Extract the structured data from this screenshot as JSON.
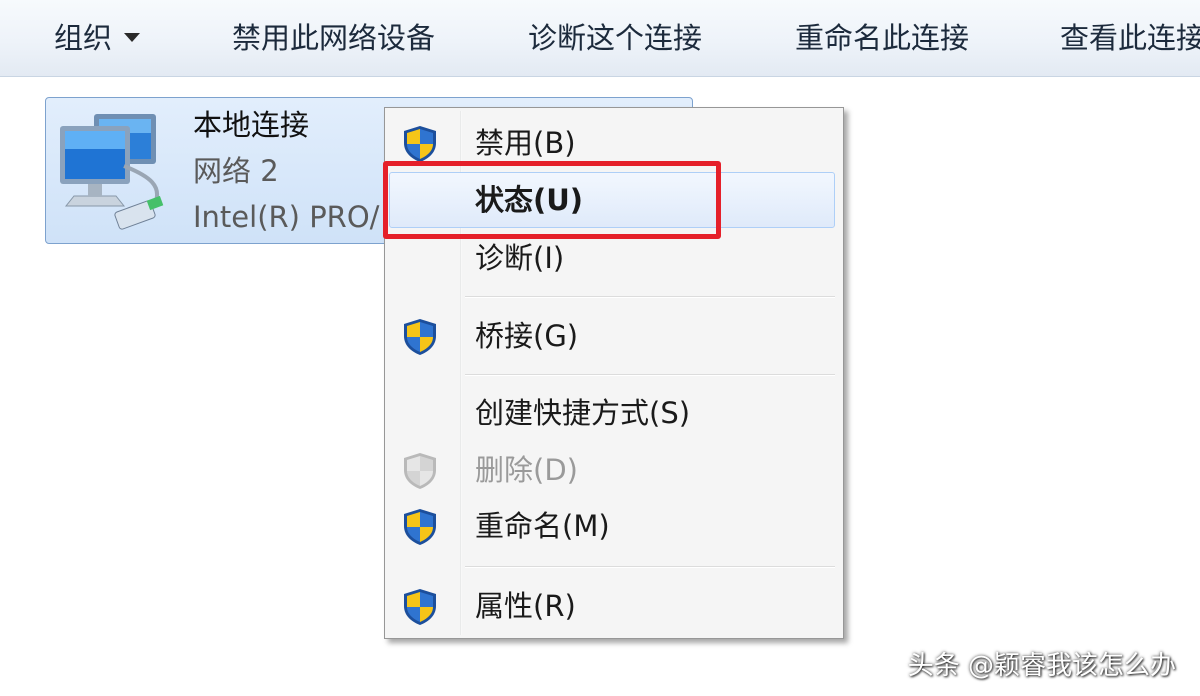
{
  "toolbar": {
    "organize_label": "组织",
    "disable_device_label": "禁用此网络设备",
    "diagnose_label": "诊断这个连接",
    "rename_label": "重命名此连接",
    "view_status_label": "查看此连接"
  },
  "connection": {
    "name": "本地连接",
    "network": "网络 2",
    "adapter": "Intel(R) PRO/"
  },
  "context_menu": {
    "items": [
      {
        "label": "禁用(B)",
        "icon": "uac-shield-icon"
      },
      {
        "label": "状态(U)",
        "icon": "none",
        "default": true,
        "highlighted": true
      },
      {
        "label": "诊断(I)",
        "icon": "none"
      },
      {
        "label": "桥接(G)",
        "icon": "uac-shield-icon"
      },
      {
        "label": "创建快捷方式(S)",
        "icon": "none"
      },
      {
        "label": "删除(D)",
        "icon": "uac-shield-icon",
        "disabled": true
      },
      {
        "label": "重命名(M)",
        "icon": "uac-shield-icon"
      },
      {
        "label": "属性(R)",
        "icon": "uac-shield-icon"
      }
    ]
  },
  "annotation": {
    "highlight_color": "#e5202a",
    "highlighted_item": "状态(U)"
  },
  "watermark": "头条 @颖睿我该怎么办",
  "colors": {
    "menu_hover": "#dfeafa",
    "selection_border": "#7da2ce"
  }
}
